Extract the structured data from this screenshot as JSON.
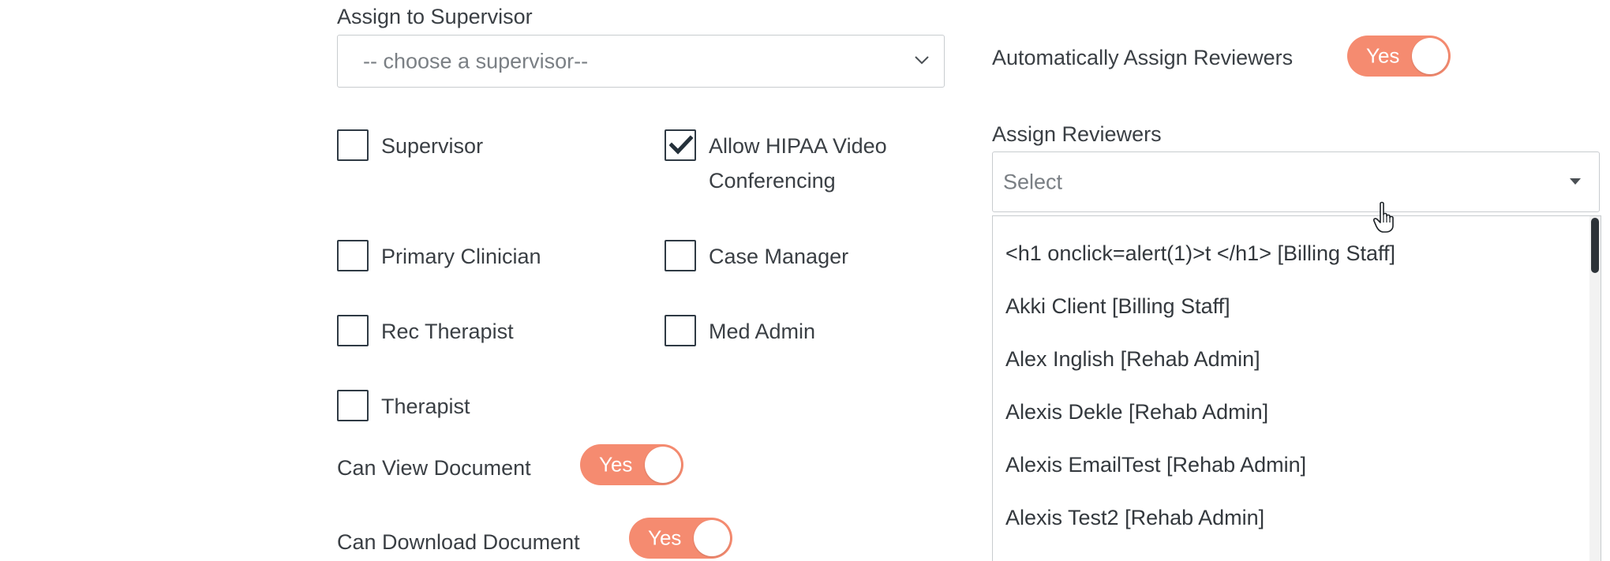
{
  "supervisor": {
    "label": "Assign to Supervisor",
    "placeholder": "-- choose a supervisor--"
  },
  "auto_assign": {
    "label": "Automatically Assign Reviewers",
    "toggle_label": "Yes",
    "enabled": true
  },
  "roles": {
    "supervisor": {
      "label": "Supervisor",
      "checked": false
    },
    "allow_hipaa_line1": "Allow HIPAA Video",
    "allow_hipaa_line2": "Conferencing",
    "allow_hipaa_checked": true,
    "primary_clinician": {
      "label": "Primary Clinician",
      "checked": false
    },
    "case_manager": {
      "label": "Case Manager",
      "checked": false
    },
    "rec_therapist": {
      "label": "Rec Therapist",
      "checked": false
    },
    "med_admin": {
      "label": "Med Admin",
      "checked": false
    },
    "therapist": {
      "label": "Therapist",
      "checked": false
    }
  },
  "can_view": {
    "label": "Can View Document",
    "toggle_label": "Yes",
    "enabled": true
  },
  "can_download": {
    "label": "Can Download Document",
    "toggle_label": "Yes",
    "enabled": true
  },
  "reviewers": {
    "label": "Assign Reviewers",
    "placeholder": "Select",
    "options": [
      "<h1 onclick=alert(1)>t </h1> [Billing Staff]",
      "Akki Client [Billing Staff]",
      "Alex Inglish [Rehab Admin]",
      "Alexis Dekle [Rehab Admin]",
      "Alexis EmailTest [Rehab Admin]",
      "Alexis Test2 [Rehab Admin]"
    ]
  },
  "colors": {
    "toggle_on": "#f58b70",
    "border": "#c8cccf",
    "checkbox_border": "#2f3a44"
  },
  "icons": {
    "select_chevron": "chevron-down-icon",
    "dropdown_caret": "caret-down-icon",
    "checkmark": "checkmark-icon",
    "cursor": "hand-pointer-icon"
  }
}
